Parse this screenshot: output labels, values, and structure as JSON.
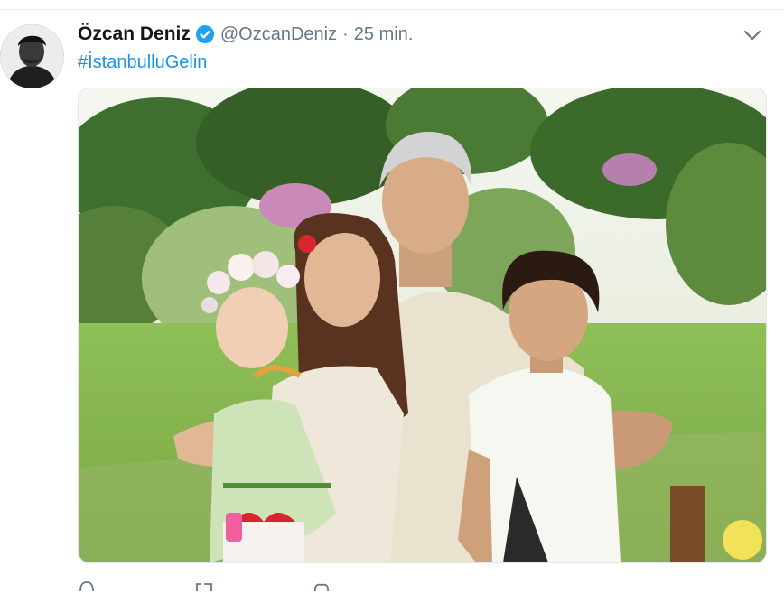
{
  "tweet": {
    "display_name": "Özcan Deniz",
    "handle": "@OzcanDeniz",
    "separator": "·",
    "time": "25 min.",
    "hashtag": "#İstanbulluGelin"
  },
  "icons": {
    "verified": "verified-badge-icon",
    "menu": "chevron-down-icon",
    "reply": "reply-icon",
    "retweet": "retweet-icon",
    "like": "heart-icon"
  },
  "colors": {
    "link": "#1b95e0",
    "verified": "#1da1f2",
    "muted": "#657786",
    "text": "#14171a"
  }
}
